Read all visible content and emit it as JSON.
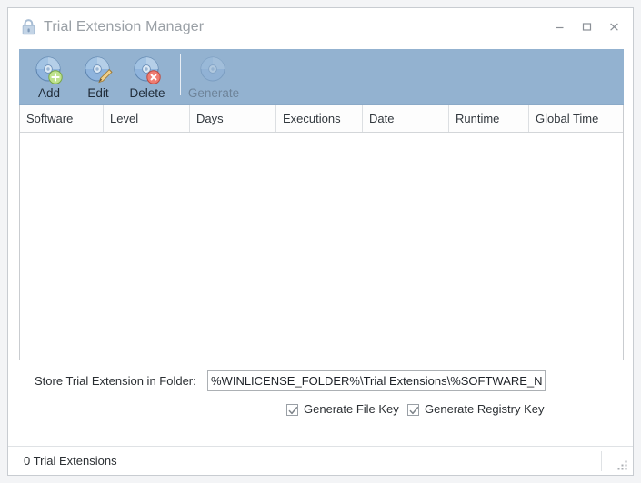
{
  "window": {
    "title": "Trial Extension Manager",
    "icon": "padlock-icon",
    "controls": {
      "minimize": "minimize-icon",
      "maximize": "maximize-icon",
      "close": "close-icon"
    }
  },
  "toolbar": {
    "background": "#93b2d0",
    "buttons": [
      {
        "label": "Add",
        "icon": "disc-add-icon",
        "enabled": true
      },
      {
        "label": "Edit",
        "icon": "disc-edit-icon",
        "enabled": true
      },
      {
        "label": "Delete",
        "icon": "disc-delete-icon",
        "enabled": true
      },
      {
        "label": "Generate",
        "icon": "disc-generate-icon",
        "enabled": false
      }
    ]
  },
  "grid": {
    "columns": [
      {
        "label": "Software",
        "width": 92
      },
      {
        "label": "Level",
        "width": 95
      },
      {
        "label": "Days",
        "width": 95
      },
      {
        "label": "Executions",
        "width": 95
      },
      {
        "label": "Date",
        "width": 95
      },
      {
        "label": "Runtime",
        "width": 88
      },
      {
        "label": "Global Time",
        "width": 103
      }
    ],
    "rows": []
  },
  "folder": {
    "label": "Store Trial Extension in Folder:",
    "value": "%WINLICENSE_FOLDER%\\Trial Extensions\\%SOFTWARE_NAME%",
    "placeholder": ""
  },
  "options": {
    "file_key": {
      "label": "Generate File Key",
      "checked": true
    },
    "registry_key": {
      "label": "Generate Registry Key",
      "checked": true
    }
  },
  "status": {
    "text": "0 Trial Extensions",
    "grip": "resize-grip-icon"
  }
}
